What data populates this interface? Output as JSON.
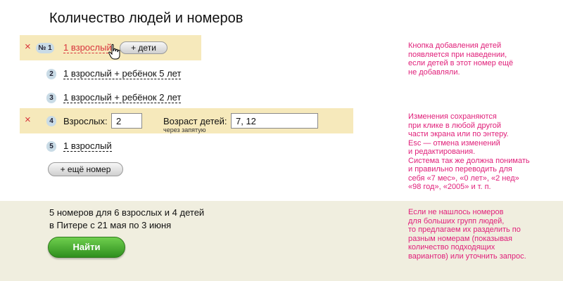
{
  "title": "Количество людей и номеров",
  "rooms": [
    {
      "number": "№ 1",
      "label": "1 взрослый",
      "add_kids_label": "+ дети"
    },
    {
      "number": "2",
      "label": "1 взрослый + ребёнок 5 лет"
    },
    {
      "number": "3",
      "label": "1 взрослый + ребёнок 2 лет"
    },
    {
      "number": "4",
      "adults_label": "Взрослых:",
      "adults_value": "2",
      "ages_label": "Возраст детей:",
      "ages_hint": "через запятую",
      "ages_value": "7, 12"
    },
    {
      "number": "5",
      "label": "1 взрослый"
    }
  ],
  "delete_icon": "×",
  "add_room_label": "+ ещё номер",
  "summary": {
    "line1": "5 номеров для 6 взрослых и 4 детей",
    "line2": "в Питере с 21 мая по 3 июня"
  },
  "find_label": "Найти",
  "notes": {
    "note1": [
      "Кнопка добавления детей",
      "появляется при наведении,",
      "если детей в этот номер ещё",
      "не добавляли."
    ],
    "note2": [
      "Изменения сохраняются",
      "при клике в любой другой",
      "части экрана или по энтеру.",
      "Esc — отмена изменений",
      "и редактирования.",
      "Система так же должна понимать",
      "и правильно переводить для",
      "себя «7 мес», «0 лет», «2 нед»",
      "«98 год», «2005» и т. п."
    ],
    "note3": [
      "Если не нашлось номеров",
      "для больших групп людей,",
      "то предлагаем их разделить по",
      "разным номерам (показывая",
      "количество подходящих",
      "вариантов) или уточнить запрос."
    ]
  },
  "colors": {
    "highlight": "#f6e9bb",
    "footer": "#f0eedf",
    "note": "#e0207a",
    "delete": "#d8333b",
    "find_button": "#3fa52a"
  },
  "icons": {
    "cursor": "hand-pointer-icon",
    "delete": "close-icon"
  }
}
